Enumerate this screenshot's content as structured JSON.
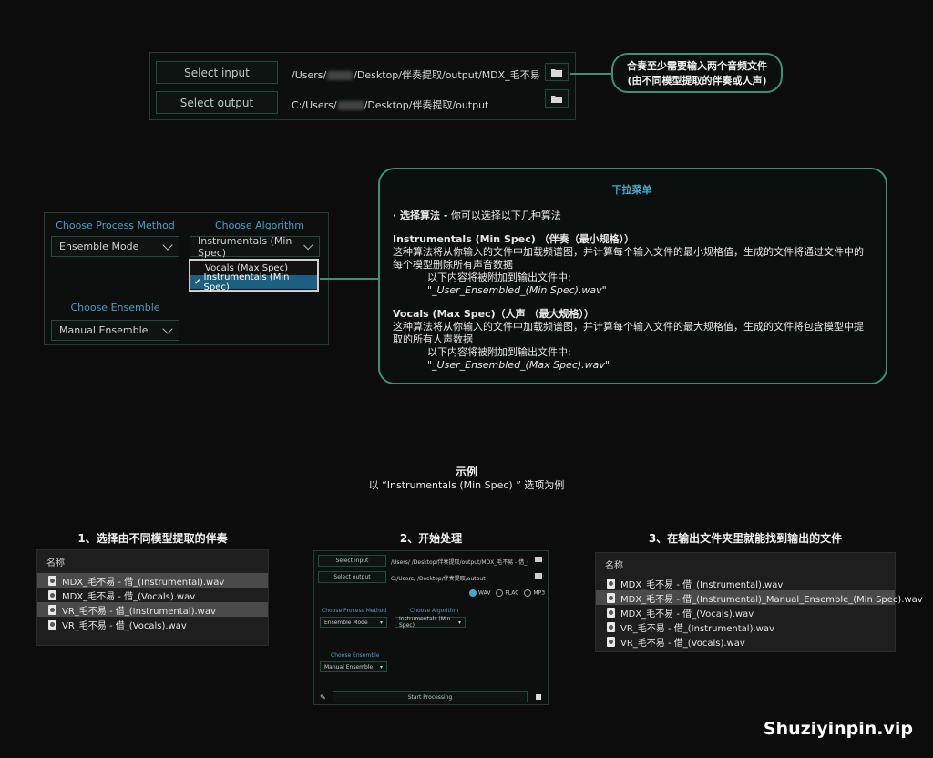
{
  "top_panel": {
    "select_input_label": "Select input",
    "select_output_label": "Select output",
    "input_path_a": "/Users/",
    "input_path_b": "/Desktop/伴奏提取/output/MDX_毛不易 - 借_(Ins",
    "output_path_a": "C:/Users/",
    "output_path_b": "/Desktop/伴奏提取/output",
    "folder_icon": "folder-icon"
  },
  "callout_top": {
    "line1": "合奏至少需要输入两个音频文件",
    "line2": "(由不同模型提取的伴奏或人声)"
  },
  "settings_panel": {
    "process_method_label": "Choose Process Method",
    "process_method_value": "Ensemble Mode",
    "algorithm_label": "Choose Algorithm",
    "algorithm_value": "Instrumentals (Min Spec)",
    "ensemble_label": "Choose Ensemble",
    "ensemble_value": "Manual Ensemble",
    "dropdown_options": [
      "Vocals (Max Spec)",
      "Instrumentals (Min Spec)"
    ],
    "dropdown_selected": "Instrumentals (Min Spec)",
    "check_mark": "✔"
  },
  "callout_menu": {
    "title": "下拉菜单",
    "intro_bold": "· 选择算法 -",
    "intro_rest": " 你可以选择以下几种算法",
    "opt1_title": "Instrumentals (Min Spec) （伴奏（最小规格））",
    "opt1_desc": "这种算法将从你输入的文件中加载频谱图，并计算每个输入文件的最小规格值，生成的文件将通过文件中的每个模型删除所有声音数据",
    "opt1_append": "以下内容将被附加到输出文件中:",
    "opt1_suffix": "\"_User_Ensembled_(Min Spec).wav\"",
    "opt2_title": "Vocals (Max Spec)（人声 （最大规格））",
    "opt2_desc": "这种算法将从你输入的文件中加载频谱图，并计算每个输入文件的最大规格值，生成的文件将包含模型中提取的所有人声数据",
    "opt2_append": "以下内容将被附加到输出文件中:",
    "opt2_suffix": "\"_User_Ensembled_(Max Spec).wav\""
  },
  "example": {
    "title": "示例",
    "subtitle": "以 “Instrumentals (Min Spec) ” 选项为例"
  },
  "steps": {
    "step1_title": "1、选择由不同模型提取的伴奏",
    "step2_title": "2、开始处理",
    "step3_title": "3、在输出文件夹里就能找到输出的文件"
  },
  "file_list_1": {
    "header": "名称",
    "rows": [
      {
        "name": "MDX_毛不易 - 借_(Instrumental).wav"
      },
      {
        "name": "MDX_毛不易 - 借_(Vocals).wav"
      },
      {
        "name": "VR_毛不易 - 借_(Instrumental).wav"
      },
      {
        "name": "VR_毛不易 - 借_(Vocals).wav"
      }
    ]
  },
  "mini_app": {
    "select_input_label": "Select input",
    "select_output_label": "Select output",
    "input_path": "/Users/       /Desktop/伴奏提取/output/MDX_毛不易 - 借_(Ins",
    "output_path": "C:/Users/       /Desktop/伴奏提取/output",
    "format_wav": "WAV",
    "format_flac": "FLAC",
    "format_mp3": "MP3",
    "process_method_label": "Choose Process Method",
    "process_method_value": "Ensemble Mode",
    "algorithm_label": "Choose Algorithm",
    "algorithm_value": "Instrumentals (Min Spec)",
    "ensemble_label": "Choose Ensemble",
    "ensemble_value": "Manual Ensemble",
    "start_label": "Start Processing"
  },
  "file_list_3": {
    "header": "名称",
    "rows": [
      {
        "name": "MDX_毛不易 - 借_(Instrumental).wav"
      },
      {
        "name": "MDX_毛不易 - 借_(Instrumental)_Manual_Ensemble_(Min Spec).wav"
      },
      {
        "name": "MDX_毛不易 - 借_(Vocals).wav"
      },
      {
        "name": "VR_毛不易 - 借_(Instrumental).wav"
      },
      {
        "name": "VR_毛不易 - 借_(Vocals).wav"
      }
    ]
  },
  "watermark": "Shuziyinpin.vip",
  "colors": {
    "accent_teal": "#4aa7c9",
    "callout_border": "#3f8f74",
    "selected_blue": "#1c5f80"
  }
}
